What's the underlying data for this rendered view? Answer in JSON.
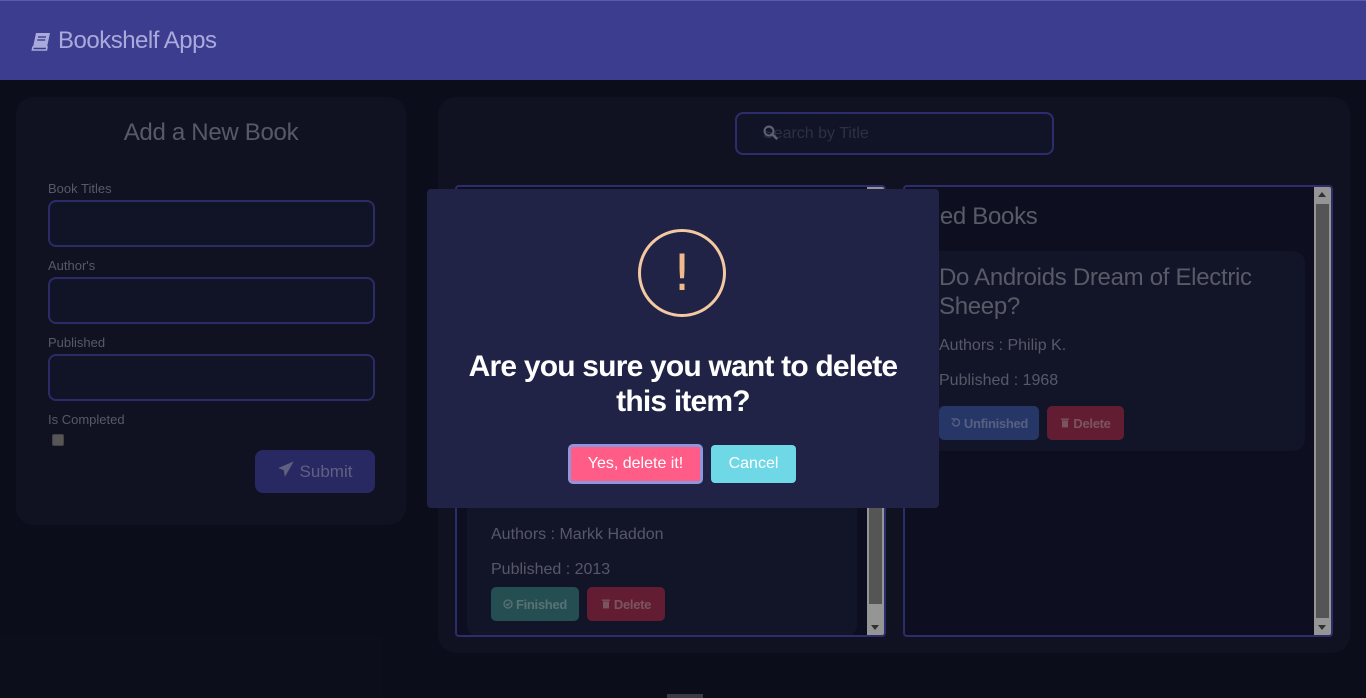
{
  "header": {
    "title": "Bookshelf Apps"
  },
  "form": {
    "title": "Add a New Book",
    "labels": {
      "title": "Book Titles",
      "author": "Author's",
      "published": "Published",
      "completed": "Is Completed"
    },
    "submit_label": "Submit"
  },
  "search": {
    "placeholder": "Search by Title"
  },
  "unfinished_shelf": {
    "books": [
      {
        "title": "",
        "authors": "Authors : Markk Haddon",
        "published": "Published : 2013",
        "finish_label": "Finished",
        "delete_label": "Delete"
      }
    ]
  },
  "finished_shelf": {
    "title": "nished Books",
    "books": [
      {
        "title": "Do Androids Dream of Electric Sheep?",
        "authors": "Authors : Philip K.",
        "published": "Published : 1968",
        "unfinish_label": "Unfinished",
        "delete_label": "Delete"
      }
    ]
  },
  "dialog": {
    "icon": "!",
    "message": "Are you sure you want to delete this item?",
    "confirm_label": "Yes, delete it!",
    "cancel_label": "Cancel"
  },
  "colors": {
    "header": "#3d3d90",
    "confirm": "#ff5c88",
    "cancel": "#6fd8e6",
    "finished_button": "#3c7f86",
    "delete_button": "#a03052",
    "unfinished_button": "#3c58a6"
  }
}
